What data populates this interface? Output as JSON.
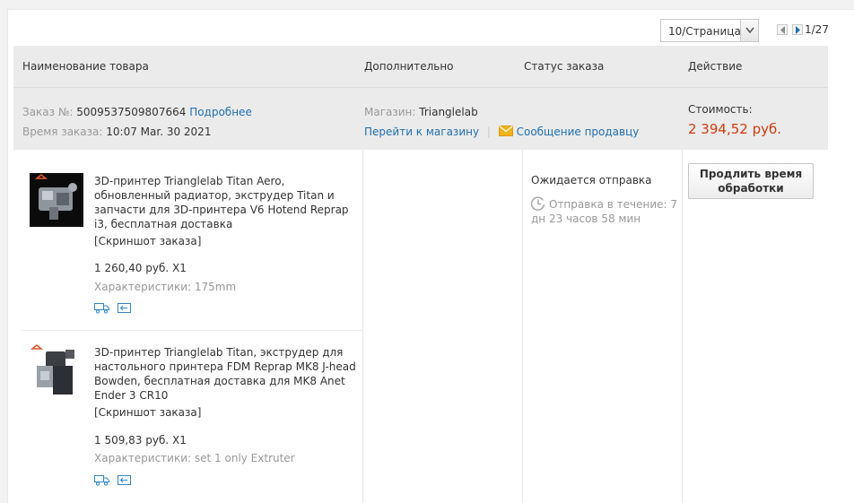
{
  "pagination": {
    "per_page": "10/Страница",
    "count": "1/27"
  },
  "columns": {
    "product": "Наименование товара",
    "extra": "Дополнительно",
    "status": "Статус заказа",
    "action": "Действие"
  },
  "order": {
    "number_label": "Заказ №:",
    "number": "5009537509807664",
    "details_link": "Подробнее",
    "time_label": "Время заказа:",
    "time": "10:07 Mar. 30 2021",
    "store_label": "Магазин:",
    "store": "Trianglelab",
    "goto_store": "Перейти к магазину",
    "separator": "|",
    "message_seller": "Сообщение продавцу",
    "cost_label": "Стоимость:",
    "cost": "2 394,52 руб.",
    "status": "Ожидается отправка",
    "shipping_info": "Отправка в течение: 7 дн 23 часов 58 мин",
    "extend_button": "Продлить время обработки"
  },
  "items": [
    {
      "title": "3D-принтер Trianglelab Titan Aero, обновленный радиатор, экструдер Titan и запчасти для 3D-принтера V6 Hotend Reprap i3, бесплатная доставка",
      "screenshot": "[Скриншот заказа]",
      "price": "1 260,40 руб. X1",
      "specs": "Характеристики: 175mm"
    },
    {
      "title": "3D-принтер Trianglelab Titan, экструдер для настольного принтера FDM Reprap MK8 J-head Bowden, бесплатная доставка для MK8 Anet Ender 3 CR10",
      "screenshot": "[Скриншот заказа]",
      "price": "1 509,83 руб. X1",
      "specs": "Характеристики: set 1 only Extruter"
    }
  ],
  "colors": {
    "link": "#1f6fb2",
    "price": "#d23a0e",
    "header_bg": "#ebebeb"
  }
}
